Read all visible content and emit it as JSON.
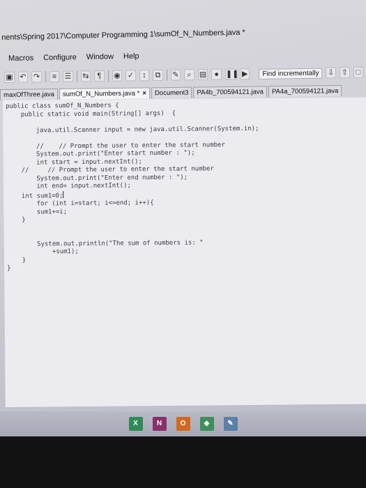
{
  "window": {
    "title": "nents\\Spring 2017\\Computer Programming 1\\sumOf_N_Numbers.java *"
  },
  "menu": [
    "Macros",
    "Configure",
    "Window",
    "Help"
  ],
  "toolbar": {
    "find_label": "Find incrementally"
  },
  "tabs": [
    {
      "label": "maxOfThree.java",
      "active": false,
      "closable": false
    },
    {
      "label": "sumOf_N_Numbers.java *",
      "active": true,
      "closable": true
    },
    {
      "label": "Document3",
      "active": false,
      "closable": false
    },
    {
      "label": "PA4b_700594121.java",
      "active": false,
      "closable": false
    },
    {
      "label": "PA4a_700594121.java",
      "active": false,
      "closable": false
    }
  ],
  "code_lines": [
    "public class sumOf_N_Numbers {",
    "    public static void main(String[] args)  {",
    "",
    "        java.util.Scanner input = new java.util.Scanner(System.in);",
    "",
    "        //    // Prompt the user to enter the start number",
    "        System.out.print(\"Enter start number : \");",
    "        int start = input.nextInt();",
    "    //     // Prompt the user to enter the start number",
    "        System.out.print(\"Enter end number : \");",
    "        int end= input.nextInt();",
    "    int sum1=0;",
    "        for (int i=start; i<=end; i++){",
    "        sum1+=i;",
    "    }",
    "",
    "",
    "        System.out.println(\"The sum of numbers is: \"",
    "            +sum1);",
    "    }",
    "}"
  ],
  "colors": {
    "editor_bg": "#ececf0",
    "keyword": "#3a3aa8",
    "code_text": "#3a3a42"
  }
}
